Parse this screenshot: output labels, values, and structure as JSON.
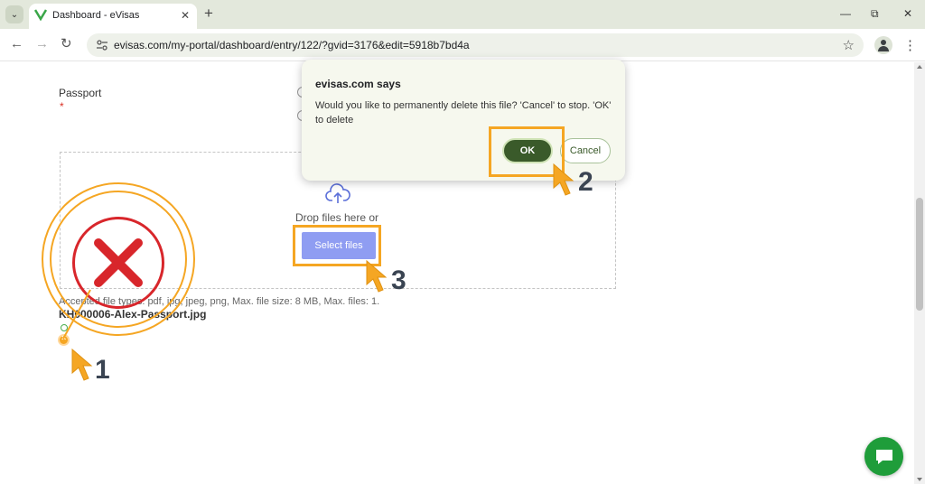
{
  "browser": {
    "tab_title": "Dashboard - eVisas",
    "url": "evisas.com/my-portal/dashboard/entry/122/?gvid=3176&edit=5918b7bd4a",
    "controls": {
      "minimize": "—",
      "restore": "⧉",
      "close": "✕",
      "new_tab": "+",
      "tab_close": "✕",
      "back": "←",
      "forward": "→",
      "reload": "↻",
      "bookmark": "☆",
      "menu": "⋮",
      "tab_search": "⌄"
    }
  },
  "form": {
    "field_label": "Passport",
    "required_mark": "*",
    "dropzone_text": "Drop files here or",
    "select_button": "Select files",
    "accepted_text": "Accepted file types: pdf, jpg, jpeg, png, Max. file size: 8 MB, Max. files: 1.",
    "uploaded_file": "KH000006-Alex-Passport.jpg",
    "delete_glyph": "×"
  },
  "dialog": {
    "title": "evisas.com says",
    "message": "Would you like to permanently delete this file? 'Cancel' to stop. 'OK' to delete",
    "ok_label": "OK",
    "cancel_label": "Cancel"
  },
  "annotations": {
    "step1": "1",
    "step2": "2",
    "step3": "3",
    "highlight_color": "#f5a623",
    "x_color": "#d8262b"
  },
  "colors": {
    "select_button": "#8f9df2",
    "ok_button": "#3a5a2a",
    "chat_button": "#1f9d3a"
  }
}
